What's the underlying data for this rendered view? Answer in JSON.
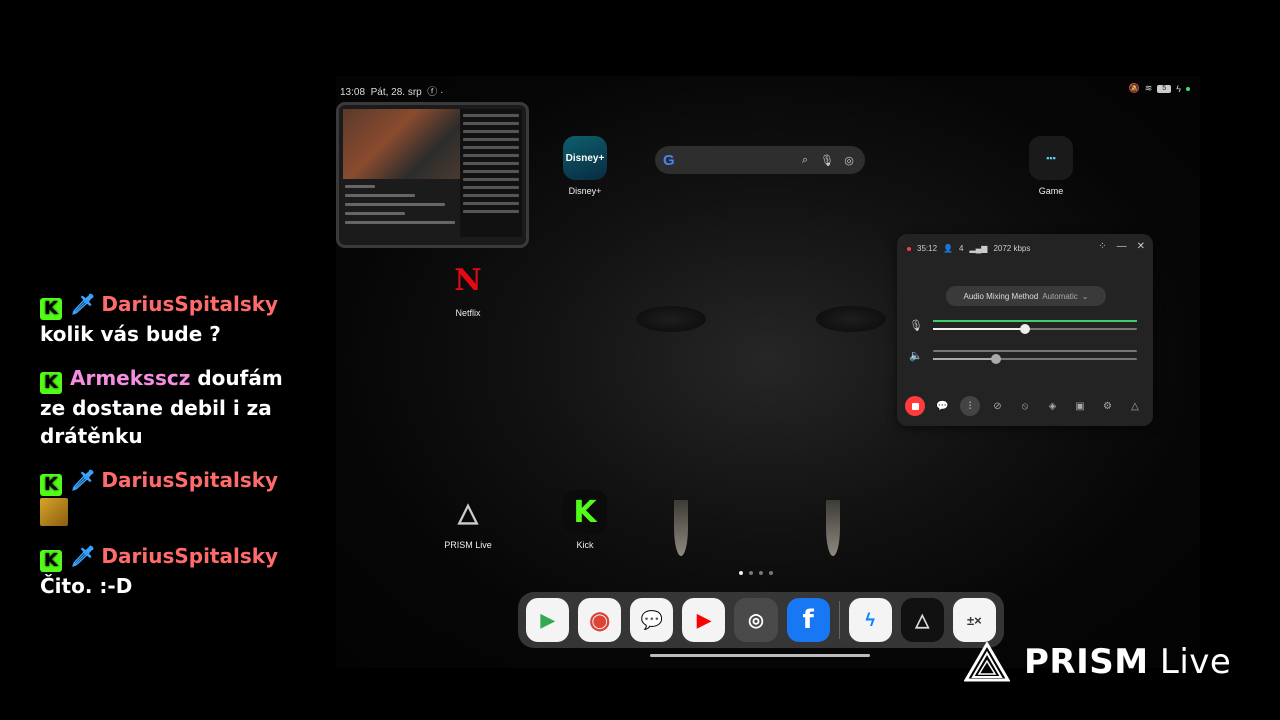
{
  "chat": {
    "messages": [
      {
        "user": "DariusSpitalsky",
        "text": "kolik vás bude ?"
      },
      {
        "user": "Armeksscz",
        "text": "doufám ze dostane debil i za drátěnku"
      },
      {
        "user": "DariusSpitalsky",
        "text": ""
      },
      {
        "user": "DariusSpitalsky",
        "text": "Čito. :-D"
      }
    ]
  },
  "status_bar": {
    "time": "13:08",
    "date": "Pát, 28. srp",
    "battery": "5"
  },
  "apps": {
    "disney": "Disney+",
    "netflix": "Netflix",
    "game": "Game",
    "prism": "PRISM Live",
    "kick": "Kick"
  },
  "stream_panel": {
    "duration": "35:12",
    "viewers": "4",
    "bitrate": "2072 kbps",
    "mixing_label": "Audio Mixing Method",
    "mixing_value": "Automatic",
    "mic_level": 0.45,
    "media_level": 0.31
  },
  "page_indicator": {
    "pages": 4,
    "current": 1
  },
  "dock": [
    "Play Store",
    "Chrome",
    "Messages",
    "YouTube",
    "Camera",
    "Facebook",
    "Messenger",
    "PRISM Live",
    "Calculator"
  ],
  "watermark": {
    "brand_bold": "PRISM",
    "brand_light": "Live"
  },
  "colors": {
    "kick_green": "#53fc18",
    "live_red": "#ff3b3b",
    "mic_fill": "#3ecf6a"
  }
}
